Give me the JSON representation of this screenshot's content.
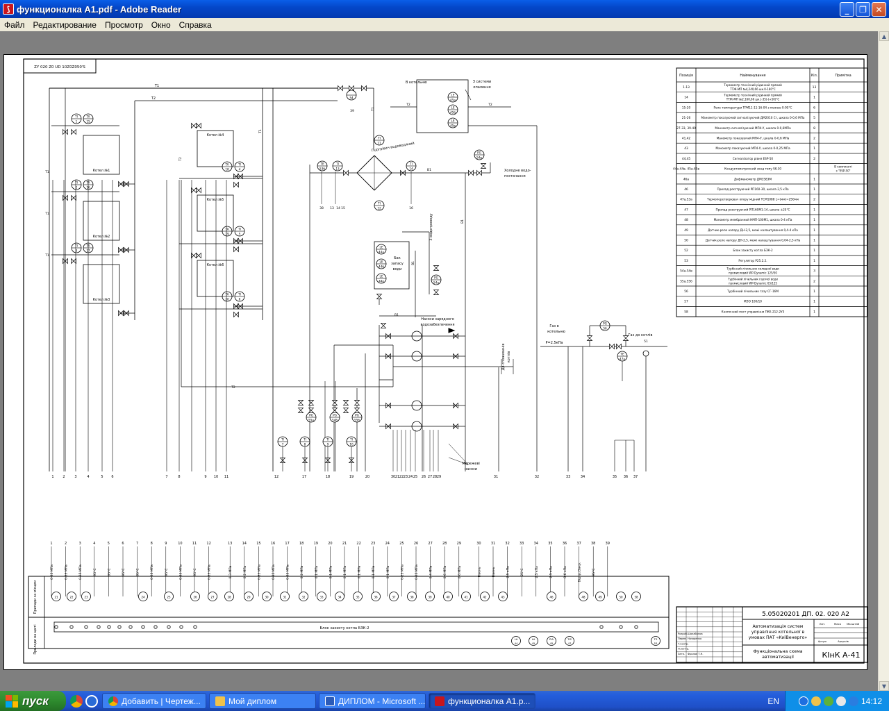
{
  "window": {
    "title": "функционалка A1.pdf - Adobe Reader",
    "app_icon": "pdf-icon"
  },
  "menu": [
    "Файл",
    "Редактирование",
    "Просмотр",
    "Окно",
    "Справка"
  ],
  "drawing": {
    "stamp_top": "ZY 020 Z0 UD 10Z0Z050'S",
    "pipes": {
      "t1": "T1",
      "t2": "T2",
      "b1": "B1"
    },
    "boilers": [
      "Котел №1",
      "Котел №2",
      "Котел №3",
      "Котел №4",
      "Котел №5",
      "Котел №6"
    ],
    "labels": {
      "to_boiler": "В котельню",
      "from_system": "З системи опалення",
      "deaerator": "Підігрівач водоводяний",
      "cold_water": "Холодна водо-постачання",
      "tank": "Бак запасу води",
      "to_water_supply": "З водопроводу",
      "pumps": "Насоси зарядного водозабезпечення",
      "to_consumers": "До споживачів котлів",
      "gas_in": "Газ в котельню",
      "gas_to": "Газ до котлів",
      "pressure": "P=2.5кПа",
      "slurry": "Мережеві насоси",
      "block": "Блок захисту котла БЗК-2",
      "row_field": "Прилади за місцем",
      "row_panel": "Прилади на щиті"
    },
    "instruments": [
      {
        "id": "TI",
        "n": "1"
      },
      {
        "id": "TA",
        "n": "15"
      },
      {
        "id": "TI",
        "n": "2"
      },
      {
        "id": "TA",
        "n": "16"
      },
      {
        "id": "TI",
        "n": "3"
      },
      {
        "id": "TA",
        "n": "17"
      },
      {
        "id": "TA",
        "n": "18"
      },
      {
        "id": "TI",
        "n": "4"
      },
      {
        "id": "TA",
        "n": "19"
      },
      {
        "id": "TI",
        "n": "5"
      },
      {
        "id": "TA",
        "n": "20"
      },
      {
        "id": "TI",
        "n": "6"
      },
      {
        "id": "TE",
        "n": "53б"
      },
      {
        "id": "TI",
        "n": "13"
      },
      {
        "id": "TI",
        "n": "11"
      },
      {
        "id": "TI",
        "n": "14"
      },
      {
        "id": "TI",
        "n": "12"
      },
      {
        "id": "PG",
        "n": "54б"
      },
      {
        "id": "LE",
        "n": "45а"
      },
      {
        "id": "LE",
        "n": "45б"
      },
      {
        "id": "LE",
        "n": "45в"
      },
      {
        "id": "LE",
        "n": "44а"
      },
      {
        "id": "LE",
        "n": "44б"
      },
      {
        "id": "LE",
        "n": "44в"
      },
      {
        "id": "PG",
        "n": "54а"
      },
      {
        "id": "PG",
        "n": "55б"
      },
      {
        "id": "PG",
        "n": "54в"
      },
      {
        "id": "PG",
        "n": "55в"
      },
      {
        "id": "TI",
        "n": "7"
      },
      {
        "id": "TI",
        "n": "8"
      },
      {
        "id": "TI",
        "n": "9"
      },
      {
        "id": "TI",
        "n": "10"
      },
      {
        "id": "PG",
        "n": "56"
      },
      {
        "id": "TE",
        "n": "47а"
      }
    ],
    "bottom_numbers": [
      "1",
      "2",
      "3",
      "4",
      "5",
      "6",
      "7",
      "8",
      "9",
      "10",
      "11",
      "12",
      "17",
      "18",
      "19",
      "20",
      "30",
      "21",
      "22",
      "23",
      "24",
      "25",
      "26",
      "27",
      "28",
      "29",
      "31",
      "32",
      "33",
      "34",
      "35",
      "36",
      "37"
    ],
    "panel_numbers": [
      "1",
      "2",
      "3",
      "4",
      "5",
      "6",
      "7",
      "8",
      "9",
      "10",
      "11",
      "12",
      "13",
      "14",
      "15",
      "16",
      "17",
      "18",
      "19",
      "20",
      "21",
      "22",
      "23",
      "24",
      "25",
      "26",
      "27",
      "28",
      "29",
      "30",
      "31",
      "32",
      "33",
      "34",
      "35",
      "36",
      "37",
      "38",
      "39"
    ],
    "panel_vertical_labels": [
      "0-35 МПа",
      "0-35 МПа",
      "0-35 МПа",
      "95°C",
      "95°C",
      "95°C",
      "95°C",
      "0-35 МПа",
      "95°C",
      "0-35 МПа",
      "95°C",
      "0-35 МПа",
      "0-3 МПа",
      "0-2 МПа",
      "0-35 МПа",
      "0-35 МПа",
      "0-35 МПа",
      "0-2 МПа",
      "0-1 МПа",
      "0-1 МПа",
      "0-1 МПа",
      "0-1 МПа",
      "0-1 МПа",
      "0-1 МПа",
      "0-25 МПа",
      "0-25 МПа",
      "0-4 МПа",
      "0-6 МПа",
      "0-6 МПа",
      "Рівень",
      "Рівень",
      "2.5 кПа",
      "25°C",
      "2.5 кПа",
      "2.5 кПа",
      "0-6 кПа",
      "Відкр./Закр.",
      "95°C",
      ""
    ],
    "panel_circles": [
      "PI 21",
      "PI 22",
      "PI 23",
      "PI 24",
      "PI 25",
      "PI 26",
      "27",
      "28",
      "29",
      "30",
      "31",
      "32",
      "33",
      "34",
      "35",
      "36",
      "37",
      "38",
      "39",
      "40",
      "41",
      "42",
      "43",
      "PI 46",
      "48",
      "PI 49",
      "PI 50",
      "PI 58"
    ],
    "panel_bottom": [
      "LA 44",
      "LA 45",
      "PIA 45",
      "TIS 47",
      "TS 53"
    ],
    "table": {
      "headers": [
        "Позиція",
        "Найменування",
        "Кіл.",
        "Примітка"
      ],
      "rows": [
        [
          "1-13",
          "Термометр технічний рідинний прямий ТТЖ-МП №4,240,66 шк.0-160°С",
          "13",
          ""
        ],
        [
          "14",
          "Термометр технічний рідинний прямий ТТЖ-МП №2,160,66 шк.(-35)-(+50)°С",
          "1",
          ""
        ],
        [
          "15-20",
          "Реле температури TPM11-11-16-04 з межею 0-95°С",
          "6",
          ""
        ],
        [
          "21-26",
          "Манометр показуючий сигналізуючий ДМ2010 Сг, шкала 0-0,6 МПа",
          "5",
          ""
        ],
        [
          "27-33, 39-40",
          "Манометр сигналізуючий МП4-У, шкала 0-0,6МПа",
          "8",
          ""
        ],
        [
          "41,42",
          "Манометр показуючий МП4-У, шкала 0-0,6 МПа",
          "2",
          ""
        ],
        [
          "43",
          "Манометр показуючий МП4-У, шкала 0-0,25 МПа",
          "1",
          ""
        ],
        [
          "44,45",
          "Сигналізатор рівня ESP-50",
          "2",
          ""
        ],
        [
          "44а-44в, 45а-45в",
          "Кондуктометричний зонд типу SK-30",
          "",
          "В комплекті з \"ESP-50\""
        ],
        [
          "46а",
          "Дифманометр ДМ3583М",
          "1",
          ""
        ],
        [
          "46",
          "Прилад реєструючий РП160-30, шкала 2,5 кПа",
          "1",
          ""
        ],
        [
          "47а,53а",
          "Термоперетворювач опору мідний ТСМ1088 L=(мм)=250мм",
          "2",
          ""
        ],
        [
          "47",
          "Прилад реєструючий РП160М1-14, шкала ±25°С",
          "1",
          ""
        ],
        [
          "48",
          "Манометр мембранний НМП-100М1, шкала 0-4 кПа",
          "1",
          ""
        ],
        [
          "49",
          "Датчик-реле напору ДН-2,5, межі налаштування 0,4-4 кПа",
          "1",
          ""
        ],
        [
          "50",
          "Датчик-реле напору ДН-2,5, межі налаштування 0,04-2,5 кПа",
          "1",
          ""
        ],
        [
          "52",
          "Блок захисту котла БЗК-2",
          "1",
          ""
        ],
        [
          "53",
          "Регулятор Р25.2.2.",
          "1",
          ""
        ],
        [
          "54а-54в",
          "Турбінний лічильник холодної води промисловий WP-Dynamic 125/50",
          "3",
          ""
        ],
        [
          "55а,55б",
          "Турбінний лічильник гарячої води промисловий WP-Dynamic 65/125",
          "2",
          ""
        ],
        [
          "56",
          "Турбінний лічильник газу СГ-16М",
          "1",
          ""
        ],
        [
          "57",
          "МЭО 100/10",
          "1",
          ""
        ],
        [
          "58",
          "Кнопочний пост управління ПКЕ-212-2У3",
          "1",
          ""
        ]
      ]
    },
    "titleblock": {
      "code": "5.05020201 ДП. 02. 020 А2",
      "title": "Автоматизація систем управління котельної в умовах ПАТ «КиїВенерго»",
      "sheet": "Функціональна схема автоматизації",
      "org": "КІнК А-41",
      "roles": [
        "Розроб.",
        "Перев.",
        "Т.контр.",
        "Н.контр.",
        "Затв."
      ],
      "names": [
        "Шалабанов",
        "Назаренко",
        "",
        "",
        "Фролов Т.Н."
      ],
      "cols": [
        "Лит.",
        "Маса",
        "Масштаб"
      ],
      "sheets": [
        "Аркуш",
        "Аркушів"
      ]
    }
  },
  "taskbar": {
    "start": "пуск",
    "tasks": [
      {
        "label": "Добавить | Чертеж...",
        "icon": "chrome-icon"
      },
      {
        "label": "Мой диплом",
        "icon": "folder-icon"
      },
      {
        "label": "ДИПЛОМ - Microsoft ...",
        "icon": "word-icon"
      },
      {
        "label": "функционалка A1.p...",
        "icon": "pdf-icon"
      }
    ],
    "lang": "EN",
    "time": "14:12"
  }
}
